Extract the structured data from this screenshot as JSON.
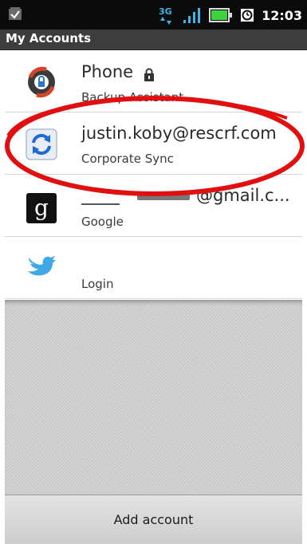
{
  "status_bar": {
    "time": "12:03",
    "network_label": "3G",
    "icons": [
      "notification-check-icon",
      "3g-data-icon",
      "signal-icon",
      "battery-icon",
      "alarm-icon"
    ],
    "network_color": "#3fb4e8",
    "signal_color": "#3fb4e8",
    "battery_color": "#3fd23f"
  },
  "header": {
    "title": "My Accounts"
  },
  "accounts": [
    {
      "primary": "Phone",
      "secondary": "Backup Assistant",
      "icon": "backup-assistant-icon",
      "badge": "lock-icon"
    },
    {
      "primary": "justin.koby@rescrf.com",
      "secondary": "Corporate Sync",
      "icon": "corporate-sync-icon"
    },
    {
      "primary": "@gmail.c...",
      "secondary": "Google",
      "icon": "google-icon"
    },
    {
      "primary": "",
      "secondary": "Login",
      "icon": "twitter-bird-icon"
    }
  ],
  "annotation": {
    "type": "circle",
    "color": "#e01010"
  },
  "footer": {
    "add_account_label": "Add account"
  }
}
